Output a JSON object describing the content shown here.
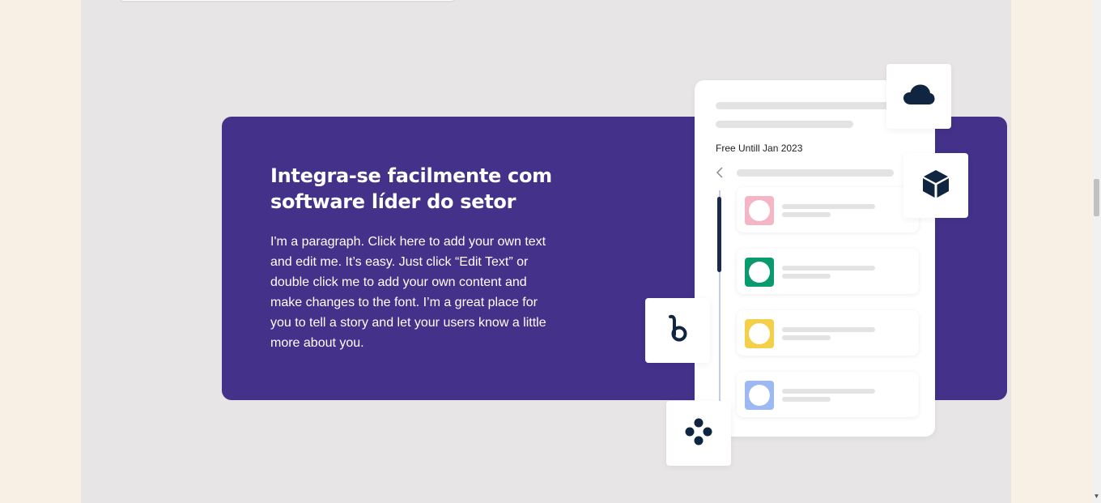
{
  "section": {
    "heading": "Integra-se facilmente com software líder do setor",
    "paragraph": "I'm a paragraph. Click here to add your own text and edit me. It’s easy. Just click “Edit Text” or double click me to add your own content and make changes to the font. I’m a great place for you to tell a story and let your users know a little more about you."
  },
  "mockup": {
    "label": "Free Untill Jan 2023",
    "rows": [
      {
        "color": "#f4b6c5"
      },
      {
        "color": "#0a9a6e"
      },
      {
        "color": "#f4d04a"
      },
      {
        "color": "#9db9f2"
      }
    ]
  },
  "icons": {
    "cloud": "cloud-icon",
    "cube": "cube-icon",
    "brand_b": "b-logo-icon",
    "dots": "dots-logo-icon",
    "back": "chevron-left-icon"
  },
  "colors": {
    "banner": "#43318a",
    "page": "#e7e5e6",
    "outer": "#f8f0e4",
    "icon": "#0f2540"
  }
}
